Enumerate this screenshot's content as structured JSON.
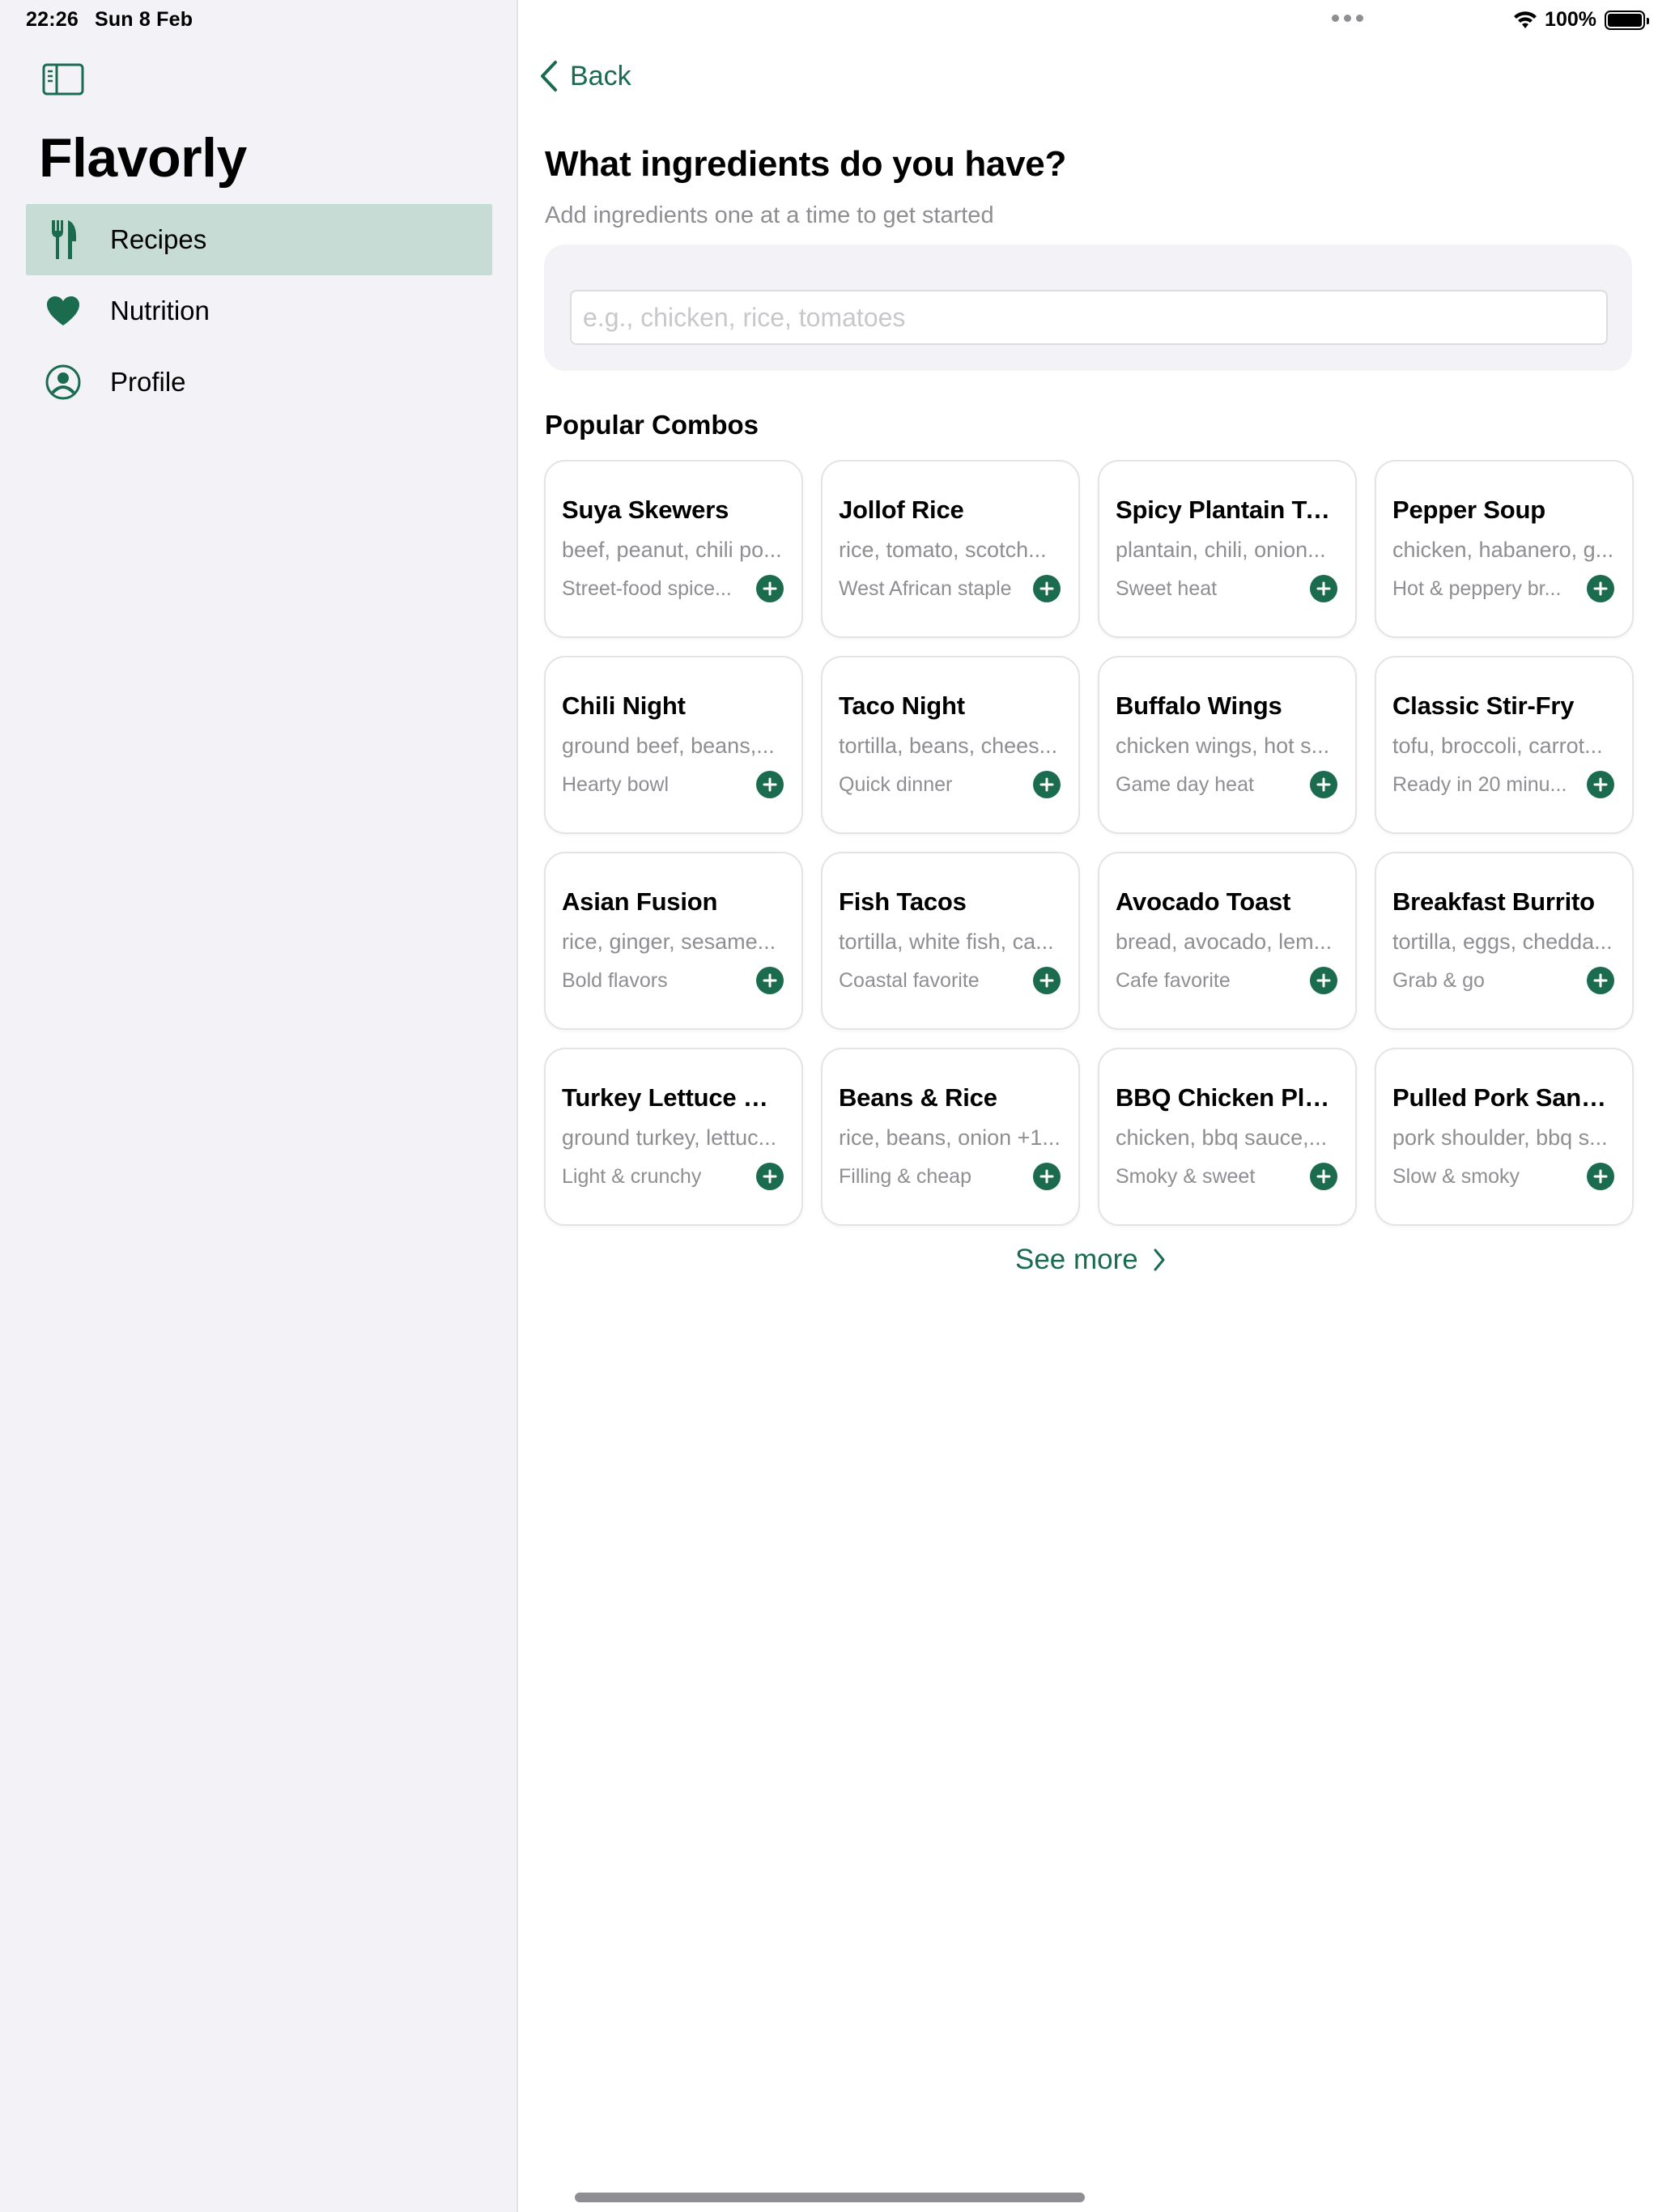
{
  "status_bar": {
    "time": "22:26",
    "date": "Sun 8 Feb",
    "battery": "100%"
  },
  "sidebar": {
    "app_title": "Flavorly",
    "items": [
      {
        "label": "Recipes",
        "icon": "fork-knife-icon",
        "active": true
      },
      {
        "label": "Nutrition",
        "icon": "heart-icon",
        "active": false
      },
      {
        "label": "Profile",
        "icon": "person-circle-icon",
        "active": false
      }
    ]
  },
  "main": {
    "back_label": "Back",
    "heading": "What ingredients do you have?",
    "subheading": "Add ingredients one at a time to get started",
    "input": {
      "value": "",
      "placeholder": "e.g., chicken, rice, tomatoes"
    },
    "section_title": "Popular Combos",
    "combos": [
      {
        "title": "Suya Skewers",
        "ingredients": "beef, peanut, chili po...",
        "tag": "Street-food spice..."
      },
      {
        "title": "Jollof Rice",
        "ingredients": "rice, tomato, scotch...",
        "tag": "West African staple"
      },
      {
        "title": "Spicy Plantain Toss",
        "ingredients": "plantain, chili, onion...",
        "tag": "Sweet heat"
      },
      {
        "title": "Pepper Soup",
        "ingredients": "chicken, habanero, g...",
        "tag": "Hot & peppery br..."
      },
      {
        "title": "Chili Night",
        "ingredients": "ground beef, beans,...",
        "tag": "Hearty bowl"
      },
      {
        "title": "Taco Night",
        "ingredients": "tortilla, beans, chees...",
        "tag": "Quick dinner"
      },
      {
        "title": "Buffalo Wings",
        "ingredients": "chicken wings, hot s...",
        "tag": "Game day heat"
      },
      {
        "title": "Classic Stir-Fry",
        "ingredients": "tofu, broccoli, carrot...",
        "tag": "Ready in 20 minu..."
      },
      {
        "title": "Asian Fusion",
        "ingredients": "rice, ginger, sesame...",
        "tag": "Bold flavors"
      },
      {
        "title": "Fish Tacos",
        "ingredients": "tortilla, white fish, ca...",
        "tag": "Coastal favorite"
      },
      {
        "title": "Avocado Toast",
        "ingredients": "bread, avocado, lem...",
        "tag": "Cafe favorite"
      },
      {
        "title": "Breakfast Burrito",
        "ingredients": "tortilla, eggs, chedda...",
        "tag": "Grab & go"
      },
      {
        "title": "Turkey Lettuce W...",
        "ingredients": "ground turkey, lettuc...",
        "tag": "Light & crunchy"
      },
      {
        "title": "Beans & Rice",
        "ingredients": "rice, beans, onion +1...",
        "tag": "Filling & cheap"
      },
      {
        "title": "BBQ Chicken Plate",
        "ingredients": "chicken, bbq sauce,...",
        "tag": "Smoky & sweet"
      },
      {
        "title": "Pulled Pork Sand...",
        "ingredients": "pork shoulder, bbq s...",
        "tag": "Slow & smoky"
      }
    ],
    "see_more_label": "See more"
  },
  "colors": {
    "accent": "#1b6b4e",
    "sidebar_bg": "#f2f2f7",
    "active_item_bg": "#c8dcd6",
    "secondary_text": "#8e8e93"
  }
}
